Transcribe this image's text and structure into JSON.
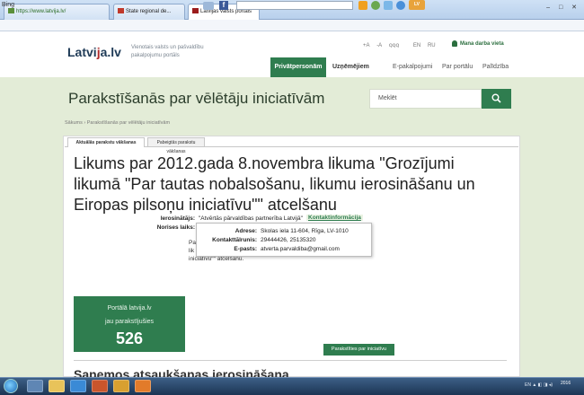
{
  "browser": {
    "address_text": "https://www.latvija.lv/",
    "tabs": [
      {
        "label": "State regional de..."
      },
      {
        "label": "Latvijas valsts portāls"
      }
    ],
    "window_controls": "– □ ✕",
    "bing_label": "Bing",
    "command_badge": "LV"
  },
  "header": {
    "logo_main": "Latvi",
    "logo_accent": "j",
    "logo_tail": "a.lv",
    "tagline": "Vienotais valsts un pašvaldību pakalpojumu portāls",
    "util_links": [
      "+A",
      "-A",
      "ꞯꞯꞯ",
      "EN",
      "RU"
    ],
    "my_account": "Mana darba vieta",
    "nav": {
      "private": "Privātpersonām",
      "business": "Uzņēmējiem",
      "eservices": "E-pakalpojumi",
      "about": "Par portālu",
      "help": "Palīdzība"
    }
  },
  "page": {
    "title": "Parakstīšanās par vēlētāju iniciatīvām",
    "search_placeholder": "Meklēt",
    "breadcrumb": "Sākums › Parakstīšanās par vēlētāju iniciatīvām"
  },
  "tabs": {
    "active": "Aktuālās parakstu vākšanas",
    "other": "Pabeigtās parakstu vākšanas"
  },
  "initiative": {
    "title": "Likums par 2012.gada 8.novembra likuma \"Grozījumi likumā \"Par tautas nobalsošanu, likumu ierosināšanu un Eiropas pilsoņu iniciatīvu\"\" atcelšanu",
    "initiator_label": "Ierosinātājs:",
    "initiator_value": "\"Atvērtās pārvaldības partnerība Latvijā\"",
    "contacts_link": "Kontaktinformācija",
    "deadline_label": "Norises laiks:",
    "deadline_value": "no",
    "description": "Pa\nlik\niniciatīvu\"\" atcelšanu.",
    "contact_popup": {
      "address_label": "Adrese:",
      "address_value": "Skolas iela 11-604, Rīga, LV-1010",
      "phone_label": "Kontakttālrunis:",
      "phone_value": "29444426, 25135320",
      "email_label": "E-pasts:",
      "email_value": "atverta.parvaldiba@gmail.com"
    },
    "counter_line1": "Portālā latvija.lv",
    "counter_line2": "jau parakstījušies",
    "counter_value": "526",
    "sign_button": "Parakstīties par iniciatīvu",
    "next_section_title": "Saņemos atsaukšanas ierosināšana"
  },
  "taskbar": {
    "tray_text": "EN  ▲  ◧  ◨  ◂)",
    "clock": "2016"
  },
  "colors": {
    "brand_green": "#2f7d4f",
    "band_bg": "#e3ecd7"
  }
}
